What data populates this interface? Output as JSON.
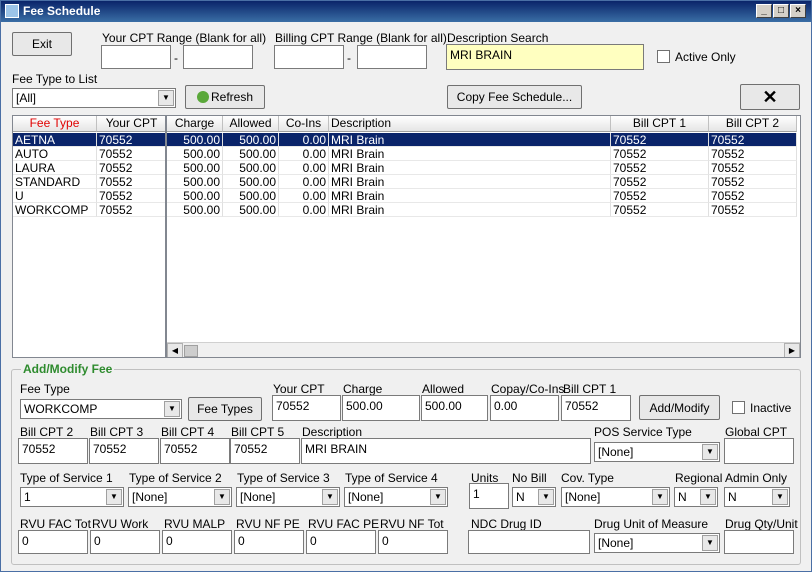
{
  "window": {
    "title": "Fee Schedule"
  },
  "toolbar": {
    "exit_label": "Exit",
    "your_cpt_range_label": "Your CPT Range (Blank for all)",
    "billing_cpt_range_label": "Billing CPT Range (Blank for all)",
    "description_search_label": "Description Search",
    "description_search_value": "MRI BRAIN",
    "active_only_label": "Active Only",
    "range_dash": "-",
    "fee_type_to_list_label": "Fee Type to List",
    "fee_type_to_list_value": "[All]",
    "refresh_label": "Refresh",
    "copy_label": "Copy Fee Schedule..."
  },
  "left_grid": {
    "columns": [
      "Fee Type",
      "Your CPT"
    ],
    "rows": [
      [
        "AETNA",
        "70552"
      ],
      [
        "AUTO",
        "70552"
      ],
      [
        "LAURA",
        "70552"
      ],
      [
        "STANDARD",
        "70552"
      ],
      [
        "U",
        "70552"
      ],
      [
        "WORKCOMP",
        "70552"
      ]
    ]
  },
  "right_grid": {
    "columns": [
      "Charge",
      "Allowed",
      "Co-Ins",
      "Description",
      "Bill CPT 1",
      "Bill CPT 2"
    ],
    "rows": [
      [
        "500.00",
        "500.00",
        "0.00",
        "MRI Brain",
        "70552",
        "70552"
      ],
      [
        "500.00",
        "500.00",
        "0.00",
        "MRI Brain",
        "70552",
        "70552"
      ],
      [
        "500.00",
        "500.00",
        "0.00",
        "MRI Brain",
        "70552",
        "70552"
      ],
      [
        "500.00",
        "500.00",
        "0.00",
        "MRI Brain",
        "70552",
        "70552"
      ],
      [
        "500.00",
        "500.00",
        "0.00",
        "MRI Brain",
        "70552",
        "70552"
      ],
      [
        "500.00",
        "500.00",
        "0.00",
        "MRI Brain",
        "70552",
        "70552"
      ]
    ]
  },
  "form": {
    "title": "Add/Modify Fee",
    "fee_type_label": "Fee Type",
    "fee_type_value": "WORKCOMP",
    "fee_types_button": "Fee Types",
    "your_cpt_label": "Your CPT",
    "your_cpt_value": "70552",
    "charge_label": "Charge",
    "charge_value": "500.00",
    "allowed_label": "Allowed",
    "allowed_value": "500.00",
    "copay_label": "Copay/Co-Ins",
    "copay_value": "0.00",
    "bill_cpt1_label": "Bill CPT 1",
    "bill_cpt1_value": "70552",
    "add_modify_button": "Add/Modify",
    "inactive_label": "Inactive",
    "bill_cpt2_label": "Bill CPT 2",
    "bill_cpt2_value": "70552",
    "bill_cpt3_label": "Bill CPT 3",
    "bill_cpt3_value": "70552",
    "bill_cpt4_label": "Bill CPT 4",
    "bill_cpt4_value": "70552",
    "bill_cpt5_label": "Bill CPT 5",
    "bill_cpt5_value": "70552",
    "description_label": "Description",
    "description_value": "MRI BRAIN",
    "pos_label": "POS Service Type",
    "pos_value": "[None]",
    "global_cpt_label": "Global CPT",
    "global_cpt_value": "",
    "tos1_label": "Type of Service 1",
    "tos1_value": "1",
    "tos2_label": "Type of Service 2",
    "tos2_value": "[None]",
    "tos3_label": "Type of Service 3",
    "tos3_value": "[None]",
    "tos4_label": "Type of Service 4",
    "tos4_value": "[None]",
    "units_label": "Units",
    "units_value": "1",
    "nobill_label": "No Bill",
    "nobill_value": "N",
    "covtype_label": "Cov. Type",
    "covtype_value": "[None]",
    "regional_label": "Regional",
    "regional_value": "N",
    "adminonly_label": "Admin Only",
    "adminonly_value": "N",
    "rvu_fac_tot_label": "RVU FAC Tot",
    "rvu_fac_tot_value": "0",
    "rvu_work_label": "RVU Work",
    "rvu_work_value": "0",
    "rvu_malp_label": "RVU MALP",
    "rvu_malp_value": "0",
    "rvu_nf_pe_label": "RVU NF PE",
    "rvu_nf_pe_value": "0",
    "rvu_fac_pe_label": "RVU FAC PE",
    "rvu_fac_pe_value": "0",
    "rvu_nf_tot_label": "RVU NF Tot",
    "rvu_nf_tot_value": "0",
    "ndc_label": "NDC Drug ID",
    "ndc_value": "",
    "drug_uom_label": "Drug Unit of Measure",
    "drug_uom_value": "[None]",
    "drug_qty_label": "Drug Qty/Unit",
    "drug_qty_value": ""
  }
}
